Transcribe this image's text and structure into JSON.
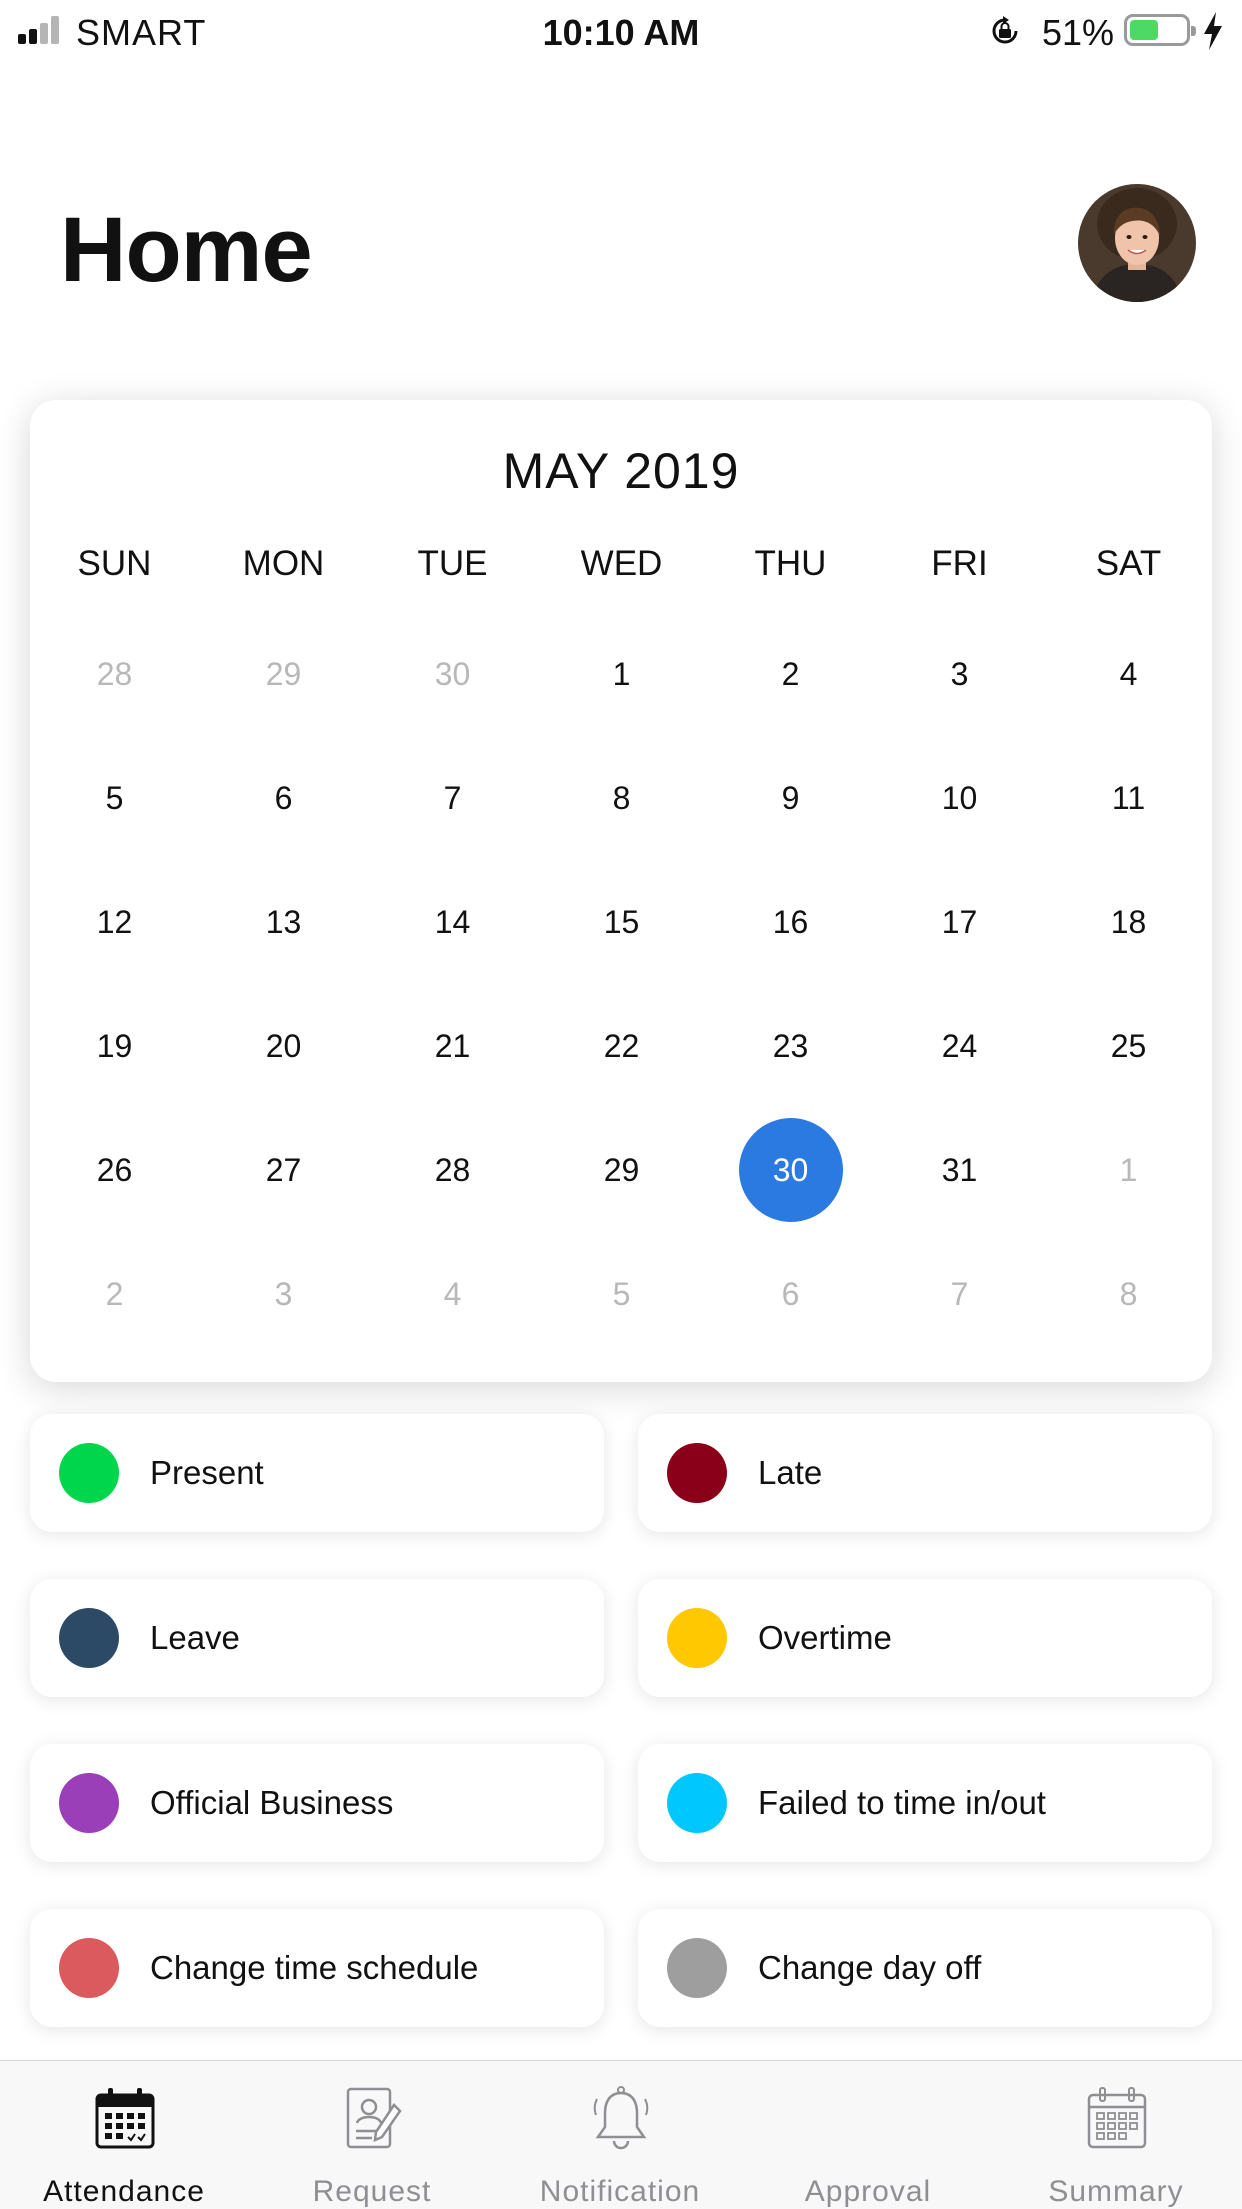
{
  "status_bar": {
    "carrier": "SMART",
    "time": "10:10 AM",
    "battery_percent": "51%",
    "battery_level": 0.51,
    "icons": [
      "signal-icon",
      "orientation-lock-icon",
      "battery-icon",
      "charging-bolt-icon"
    ]
  },
  "header": {
    "title": "Home",
    "avatar_icon": "user-avatar"
  },
  "calendar": {
    "month_label": "MAY 2019",
    "weekdays": [
      "SUN",
      "MON",
      "TUE",
      "WED",
      "THU",
      "FRI",
      "SAT"
    ],
    "weeks": [
      [
        "28",
        "29",
        "30",
        "1",
        "2",
        "3",
        "4"
      ],
      [
        "5",
        "6",
        "7",
        "8",
        "9",
        "10",
        "11"
      ],
      [
        "12",
        "13",
        "14",
        "15",
        "16",
        "17",
        "18"
      ],
      [
        "19",
        "20",
        "21",
        "22",
        "23",
        "24",
        "25"
      ],
      [
        "26",
        "27",
        "28",
        "29",
        "30",
        "31",
        "1"
      ],
      [
        "2",
        "3",
        "4",
        "5",
        "6",
        "7",
        "8"
      ]
    ],
    "selected_day": "30",
    "selected_color": "#2a7ae2"
  },
  "legend": [
    {
      "label": "Present",
      "color": "#00d64b"
    },
    {
      "label": "Late",
      "color": "#8a0018"
    },
    {
      "label": "Leave",
      "color": "#2c4a66"
    },
    {
      "label": "Overtime",
      "color": "#ffc800"
    },
    {
      "label": "Official Business",
      "color": "#9b3fb8"
    },
    {
      "label": "Failed to time in/out",
      "color": "#00c8ff"
    },
    {
      "label": "Change time schedule",
      "color": "#db5a5e"
    },
    {
      "label": "Change day off",
      "color": "#9e9e9e"
    }
  ],
  "tabs": [
    {
      "label": "Attendance",
      "icon": "calendar-icon",
      "active": true
    },
    {
      "label": "Request",
      "icon": "document-pen-icon",
      "active": false
    },
    {
      "label": "Notification",
      "icon": "bell-icon",
      "active": false
    },
    {
      "label": "Approval",
      "icon": "approval-icon",
      "active": false
    },
    {
      "label": "Summary",
      "icon": "calendar-icon",
      "active": false
    }
  ]
}
